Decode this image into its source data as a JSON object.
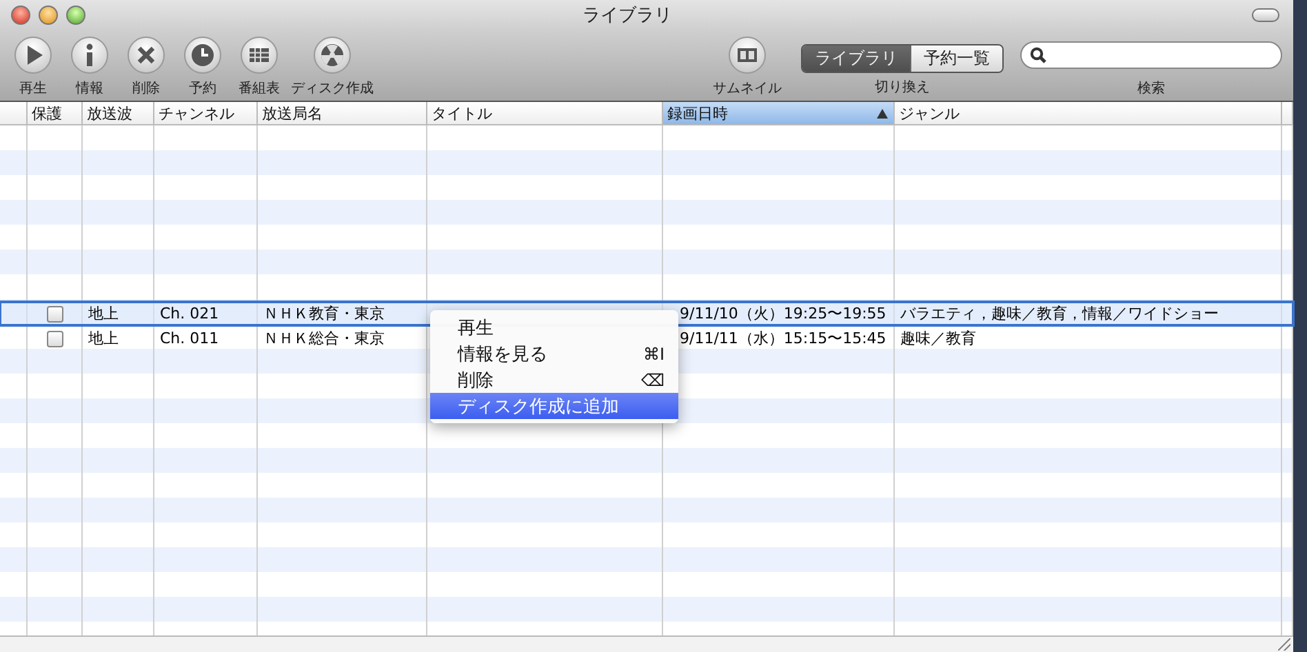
{
  "window": {
    "title": "ライブラリ"
  },
  "toolbar": {
    "buttons": [
      {
        "label": "再生",
        "kind": "play"
      },
      {
        "label": "情報",
        "kind": "info"
      },
      {
        "label": "削除",
        "kind": "delete"
      },
      {
        "label": "予約",
        "kind": "clock"
      },
      {
        "label": "番組表",
        "kind": "grid"
      },
      {
        "label": "ディスク作成",
        "kind": "disc"
      }
    ],
    "thumbnail": {
      "label": "サムネイル"
    },
    "switch": {
      "label": "切り換え",
      "segments": [
        {
          "label": "ライブラリ",
          "selected": true
        },
        {
          "label": "予約一覧",
          "selected": false
        }
      ]
    },
    "search": {
      "label": "検索"
    }
  },
  "table": {
    "columns": [
      {
        "label": "保護",
        "sorted": false
      },
      {
        "label": "放送波",
        "sorted": false
      },
      {
        "label": "チャンネル",
        "sorted": false
      },
      {
        "label": "放送局名",
        "sorted": false
      },
      {
        "label": "タイトル",
        "sorted": false
      },
      {
        "label": "録画日時",
        "sorted": true
      },
      {
        "label": "ジャンル",
        "sorted": false
      }
    ],
    "rows": [
      {
        "protected": false,
        "selected": true,
        "broadcast": "地上",
        "channel": "Ch. 021",
        "station": "ＮＨＫ教育・東京",
        "recorded": "9/11/10（火）19:25〜19:55",
        "genre": "バラエティ，趣味／教育，情報／ワイドショー"
      },
      {
        "protected": false,
        "selected": false,
        "broadcast": "地上",
        "channel": "Ch. 011",
        "station": "ＮＨＫ総合・東京",
        "recorded": "9/11/11（水）15:15〜15:45",
        "genre": "趣味／教育"
      }
    ]
  },
  "context_menu": {
    "items": [
      {
        "label": "再生",
        "selected": false
      },
      {
        "label": "情報を見る",
        "shortcut": "⌘I",
        "selected": false
      },
      {
        "label": "削除",
        "shortcut": "⌫",
        "selected": false
      },
      {
        "label": "ディスク作成に追加",
        "selected": true
      }
    ]
  }
}
